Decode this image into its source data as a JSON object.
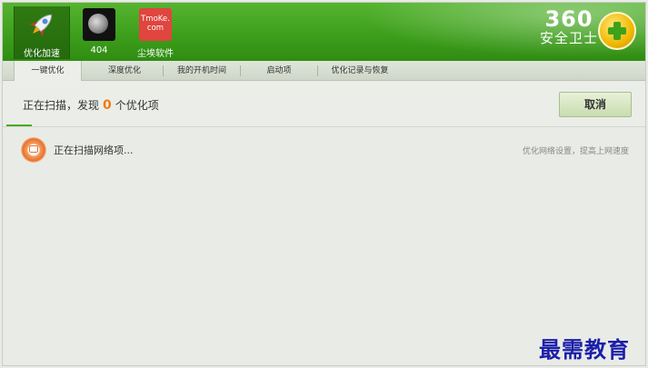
{
  "toolbar": {
    "items": [
      {
        "label": "优化加速"
      },
      {
        "label": "404"
      },
      {
        "label": "尘埃软件",
        "icon_text_1": "TmoKe.",
        "icon_text_2": "com"
      }
    ]
  },
  "brand": {
    "number": "360",
    "text": "安全卫士"
  },
  "tabs": [
    {
      "label": "一键优化"
    },
    {
      "label": "深度优化"
    },
    {
      "label": "我的开机时间"
    },
    {
      "label": "启动项"
    },
    {
      "label": "优化记录与恢复"
    }
  ],
  "status": {
    "prefix": "正在扫描，发现",
    "count": "0",
    "suffix": "个优化项"
  },
  "cancel_label": "取消",
  "scan_row": {
    "label": "正在扫描网络项...",
    "hint": "优化网络设置，提高上网速度"
  },
  "watermark": "最需教育",
  "colors": {
    "header_green": "#3e9f1c",
    "accent_orange": "#f07b14",
    "progress_green": "#4caa23"
  }
}
